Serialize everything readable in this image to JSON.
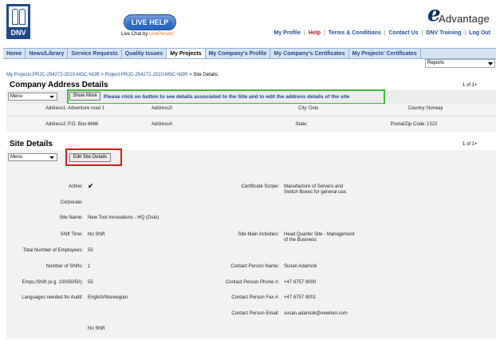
{
  "header": {
    "logo_text": "DNV",
    "livehelp_label": "LIVE HELP",
    "livechat_prefix": "Live Chat by ",
    "livechat_brand": "LivePerson",
    "brand_e": "e",
    "brand_rest": "Advantage",
    "links": {
      "profile": "My Profile",
      "help": "Help",
      "terms": "Terms & Conditions",
      "contact": "Contact Us",
      "training": "DNV Training",
      "logout": "Log Out"
    },
    "sep": "|"
  },
  "nav": {
    "tabs": [
      {
        "label": "Home"
      },
      {
        "label": "News/Library"
      },
      {
        "label": "Service Requests"
      },
      {
        "label": "Quality Issues"
      },
      {
        "label": "My Projects"
      },
      {
        "label": "My Company's Profile"
      },
      {
        "label": "My Company's Certificates"
      },
      {
        "label": "My Projects' Certificates"
      }
    ],
    "active_tab": "My Projects",
    "reports_value": "Reports"
  },
  "breadcrumb": {
    "part1": "My Projects:PRJC-254272-2010-MSC-NOR",
    "part2": " > Project:PRJC-254272-2010-MSC-NOR",
    "part3": " > Site Details:"
  },
  "company_address": {
    "title": "Company Address Details",
    "pager": "1 of 1+",
    "menu_value": "Menu",
    "show_more_label": "Show More",
    "hint": "Please click on button to see details associated to the Site and to edit the address details of the site",
    "address1_label": "Address1:",
    "address1_value": "Adventure road 1",
    "address2_label": "Address2:",
    "address2_value": "P.O. Box 6666",
    "address3_label": "Address3:",
    "address3_value": "",
    "address4_label": "Address4:",
    "address4_value": "",
    "city_label": "City:",
    "city_value": "Oslo",
    "state_label": "State:",
    "state_value": "",
    "country_label": "Country:",
    "country_value": "Norway",
    "postal_label": "Postal/Zip Code:",
    "postal_value": "1322"
  },
  "site_details": {
    "title": "Site Details",
    "pager": "1 of 1+",
    "menu_value": "Menu",
    "edit_label": "Edit Site Details",
    "left": [
      {
        "label": "Active:",
        "value": "✔"
      },
      {
        "label": "Corporate:",
        "value": ""
      },
      {
        "label": "Site Name:",
        "value": "New Tool Innovations - HQ (Oslo)"
      },
      {
        "label": "Shift Time:",
        "value": "No Shift"
      },
      {
        "label": "Total Number of Employees:",
        "value": "55"
      },
      {
        "label": "Number of Shifts:",
        "value": "1"
      },
      {
        "label": "Emps./Shift (e.g. 100/50/50):",
        "value": "55"
      },
      {
        "label": "Languages needed for Audit:",
        "value": "English/Norwegian"
      },
      {
        "label": "",
        "value": "No Shift"
      }
    ],
    "right": [
      {
        "label": "Certificate Scope:",
        "value": "Manufacture of Servers and Switch Boxes for general use."
      },
      {
        "label": "Site Main Activities:",
        "value": "Head Quarter Site - Management of the Business"
      },
      {
        "label": "Contact Person Name:",
        "value": "Susan Adamcik"
      },
      {
        "label": "Contact Person Phone #:",
        "value": "+47 6757 9000"
      },
      {
        "label": "Contact Person Fax #:",
        "value": "+47 6757 9001"
      },
      {
        "label": "Contact Person Email:",
        "value": "susan.adamcik@newtool.com"
      }
    ]
  },
  "colors": {
    "brand_blue": "#1e4a8a",
    "link_blue": "#1a4f9c",
    "nav_bg": "#d5e3f3",
    "highlight_green": "#3fb83f",
    "highlight_red": "#d31b1b"
  }
}
